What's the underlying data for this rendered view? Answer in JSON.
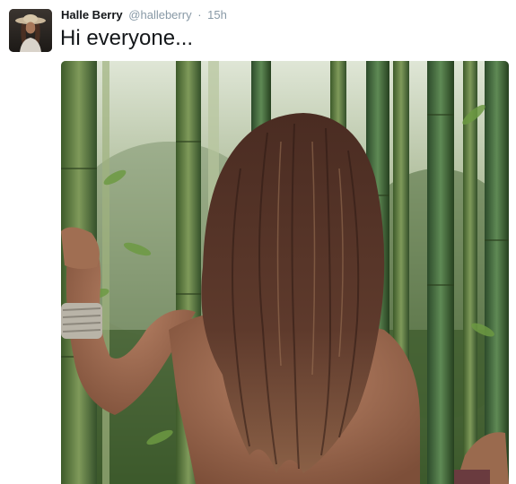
{
  "tweet": {
    "fullname": "Halle Berry",
    "username": "@halleberry",
    "separator": "·",
    "time": "15h",
    "text": "Hi everyone..."
  },
  "icons": {
    "avatar": "profile-photo",
    "media": "tweet-photo"
  },
  "colors": {
    "text": "#14171a",
    "secondary": "#8899a6",
    "background": "#ffffff"
  }
}
